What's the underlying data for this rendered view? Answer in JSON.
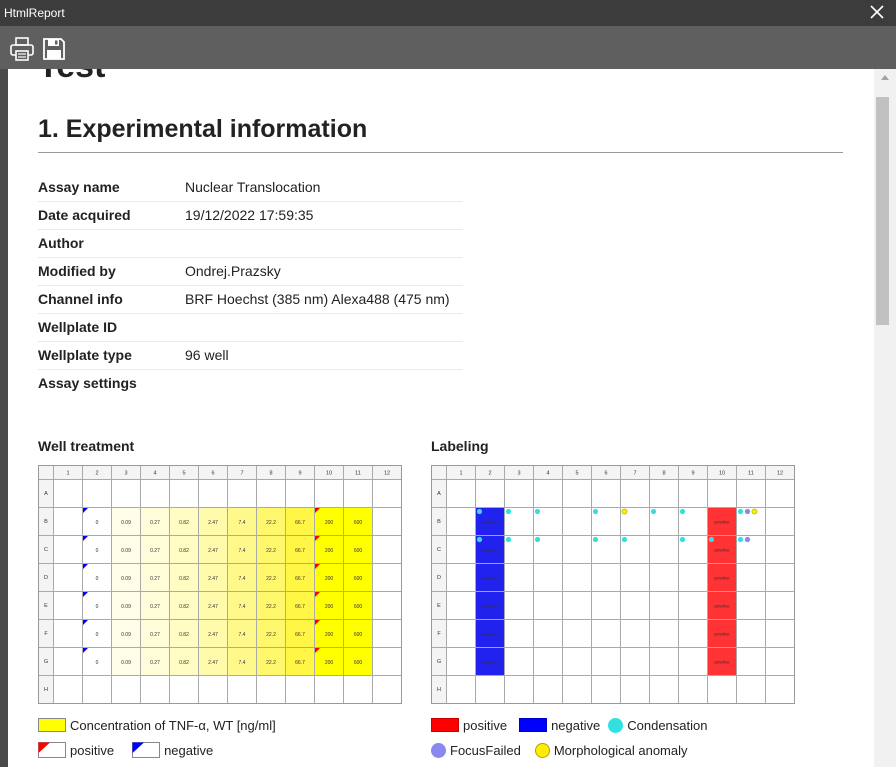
{
  "window": {
    "title": "HtmlReport"
  },
  "report": {
    "title": "Test",
    "section_title": "1. Experimental information",
    "info": [
      {
        "key": "Assay name",
        "value": "Nuclear Translocation"
      },
      {
        "key": "Date acquired",
        "value": "19/12/2022 17:59:35"
      },
      {
        "key": "Author",
        "value": ""
      },
      {
        "key": "Modified by",
        "value": "Ondrej.Prazsky"
      },
      {
        "key": "Channel info",
        "value": "BRF Hoechst (385 nm) Alexa488 (475 nm)"
      },
      {
        "key": "Wellplate ID",
        "value": ""
      },
      {
        "key": "Wellplate type",
        "value": "96 well"
      },
      {
        "key": "Assay settings",
        "value": ""
      }
    ]
  },
  "plates": {
    "columns": [
      "1",
      "2",
      "3",
      "4",
      "5",
      "6",
      "7",
      "8",
      "9",
      "10",
      "11",
      "12"
    ],
    "rows": [
      "A",
      "B",
      "C",
      "D",
      "E",
      "F",
      "G",
      "H"
    ],
    "treatment": {
      "title": "Well treatment",
      "concentrations": [
        "0",
        "0.09",
        "0.27",
        "0.82",
        "2.47",
        "7.4",
        "22.2",
        "66.7",
        "200",
        "600"
      ],
      "shades": [
        "#ffffff",
        "#fffee8",
        "#fffdd8",
        "#fffcc4",
        "#fffbab",
        "#fff98c",
        "#fff86c",
        "#fff645",
        "#ffff00",
        "#ffff00"
      ],
      "legend": {
        "concentration": "Concentration of TNF-α, WT [ng/ml]",
        "positive": "positive",
        "negative": "negative"
      }
    },
    "labeling": {
      "title": "Labeling",
      "positive_label": "positive",
      "negative_label": "negative",
      "legend": {
        "positive": "positive",
        "negative": "negative",
        "condensation": "Condensation",
        "focus_failed": "FocusFailed",
        "morph": "Morphological anomaly"
      }
    },
    "colors": {
      "positive": "#ff3333",
      "negative": "#2222ee",
      "condensation": "#33e0e0",
      "focus_failed": "#8888ee",
      "morph": "#ffee00"
    }
  }
}
